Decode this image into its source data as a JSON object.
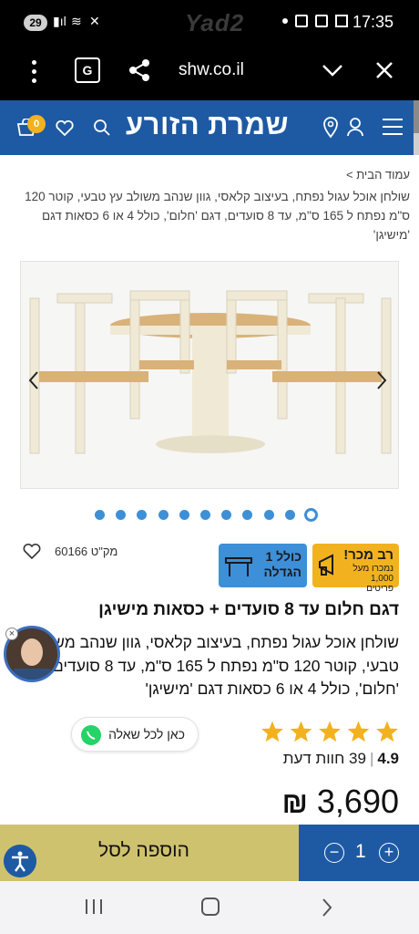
{
  "status_bar": {
    "notification_count": "29",
    "watermark": "Yad2",
    "time": "17:35"
  },
  "browser": {
    "url": "shw.co.il",
    "icons": [
      "more-icon",
      "translate-icon",
      "share-icon",
      "chevron-down-icon",
      "close-icon"
    ]
  },
  "site_header": {
    "brand": "שמרת הזורע",
    "cart_count": "0",
    "accent_color": "#1e5aa3"
  },
  "breadcrumb": {
    "home": "עמוד הבית >",
    "path": "שולחן אוכל עגול נפתח, בעיצוב קלאסי, גוון שנהב משולב עץ טבעי, קוטר 120 ס\"מ נפתח ל 165 ס\"מ, עד 8 סועדים, דגם 'חלום', כולל 4 או 6 כסאות דגם 'מישיגן'"
  },
  "gallery": {
    "dot_count": 11,
    "active_index": 0
  },
  "badges": {
    "hot_title": "רב מכר!",
    "hot_sub": "נמכרו מעל 1,000 פריטים",
    "assembly": "כולל 1 הגדלה",
    "hot_color": "#f2b21f",
    "assembly_color": "#3d8fd8"
  },
  "product": {
    "sku": "מק\"ט 60166",
    "title": "דגם חלום עד 8 סועדים + כסאות מישיגן",
    "description": "שולחן אוכל עגול נפתח, בעיצוב קלאסי, גוון שנהב משולב עץ טבעי, קוטר 120 ס\"מ נפתח ל 165 ס\"מ, עד 8 סועדים, דגם 'חלום', כולל 4 או 6 כסאות דגם 'מישיגן'",
    "rating_score": "4.9",
    "reviews": "39 חוות דעת",
    "stars": 5,
    "price": "3,690",
    "currency": "₪"
  },
  "ask": {
    "label": "כאן לכל שאלה"
  },
  "cart_bar": {
    "add_label": "הוספה לסל",
    "quantity": "1",
    "add_color": "#cfc26f"
  }
}
